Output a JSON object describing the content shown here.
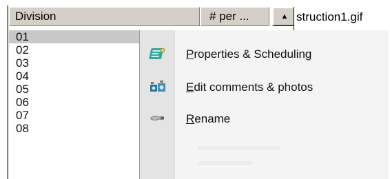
{
  "header": {
    "division_label": "Division",
    "per_label": "# per ...",
    "sort_glyph": "▲"
  },
  "file": {
    "name": "struction1.gif"
  },
  "list": {
    "items": [
      "01",
      "02",
      "03",
      "04",
      "05",
      "06",
      "07",
      "08"
    ],
    "selected_index": 0
  },
  "menu": {
    "items": [
      {
        "label_accel": "P",
        "label_rest": "roperties & Scheduling",
        "icon": "properties-icon"
      },
      {
        "label_accel": "E",
        "label_rest": "dit comments & photos",
        "icon": "photos-icon"
      },
      {
        "label_accel": "R",
        "label_rest": "ename",
        "icon": "rename-icon"
      }
    ]
  },
  "colors": {
    "header_bg": "#d4d0c8",
    "selection": "#c8c8c8",
    "menu_bg": "#f4f4f4",
    "gutter_bg": "#e4e4e4"
  }
}
